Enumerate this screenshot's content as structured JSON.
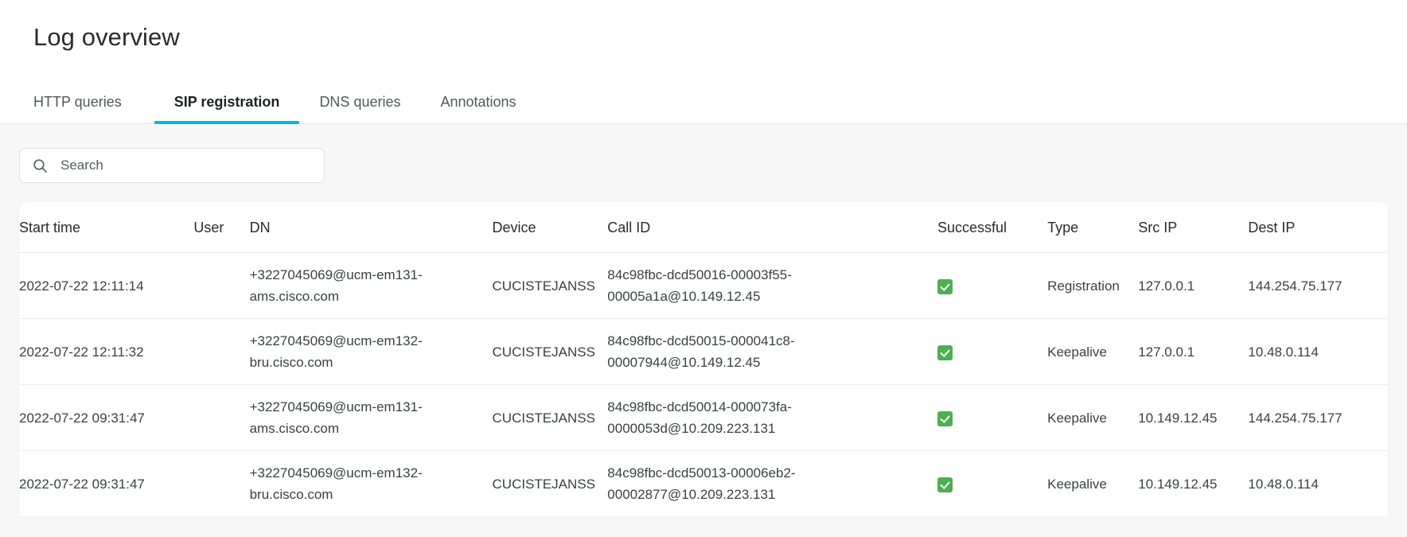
{
  "header": {
    "title": "Log overview"
  },
  "theme": {
    "accent": "#00b7e4",
    "success": "#4caf50",
    "page_bg": "#f7f7f8",
    "card_bg": "#ffffff",
    "text": "#2b2b2b"
  },
  "tabs": [
    {
      "label": "HTTP queries",
      "active": false
    },
    {
      "label": "SIP registration",
      "active": true
    },
    {
      "label": "DNS queries",
      "active": false
    },
    {
      "label": "Annotations",
      "active": false
    }
  ],
  "search": {
    "placeholder": "Search",
    "value": "",
    "icon": "search-icon"
  },
  "table": {
    "columns": [
      "Start time",
      "User",
      "DN",
      "Device",
      "Call ID",
      "Successful",
      "Type",
      "Src IP",
      "Dest IP"
    ],
    "rows": [
      {
        "start_time": "2022-07-22 12:11:14",
        "user": "",
        "dn": "+3227045069@ucm-em131-ams.cisco.com",
        "device": "CUCISTEJANSS",
        "call_id": "84c98fbc-dcd50016-00003f55-00005a1a@10.149.12.45",
        "successful": true,
        "successful_icon": "green-check-icon",
        "type": "Registration",
        "src_ip": "127.0.0.1",
        "dest_ip": "144.254.75.177"
      },
      {
        "start_time": "2022-07-22 12:11:32",
        "user": "",
        "dn": "+3227045069@ucm-em132-bru.cisco.com",
        "device": "CUCISTEJANSS",
        "call_id": "84c98fbc-dcd50015-000041c8-00007944@10.149.12.45",
        "successful": true,
        "successful_icon": "green-check-icon",
        "type": "Keepalive",
        "src_ip": "127.0.0.1",
        "dest_ip": "10.48.0.114"
      },
      {
        "start_time": "2022-07-22 09:31:47",
        "user": "",
        "dn": "+3227045069@ucm-em131-ams.cisco.com",
        "device": "CUCISTEJANSS",
        "call_id": "84c98fbc-dcd50014-000073fa-0000053d@10.209.223.131",
        "successful": true,
        "successful_icon": "green-check-icon",
        "type": "Keepalive",
        "src_ip": "10.149.12.45",
        "dest_ip": "144.254.75.177"
      },
      {
        "start_time": "2022-07-22 09:31:47",
        "user": "",
        "dn": "+3227045069@ucm-em132-bru.cisco.com",
        "device": "CUCISTEJANSS",
        "call_id": "84c98fbc-dcd50013-00006eb2-00002877@10.209.223.131",
        "successful": true,
        "successful_icon": "green-check-icon",
        "type": "Keepalive",
        "src_ip": "10.149.12.45",
        "dest_ip": "10.48.0.114"
      }
    ]
  }
}
